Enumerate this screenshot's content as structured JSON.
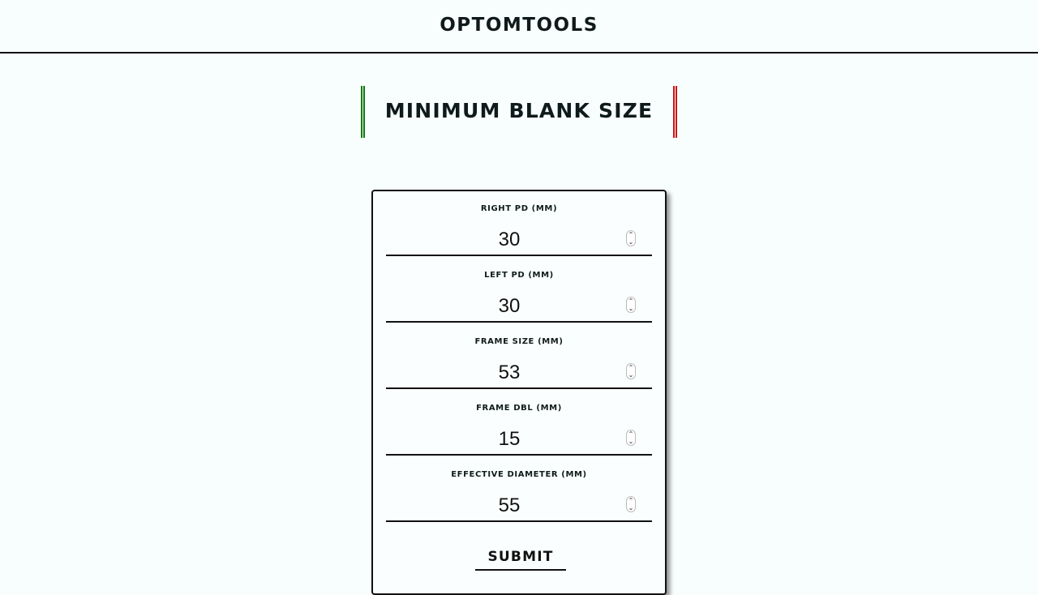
{
  "header": {
    "brand": "OPTOMTOOLS"
  },
  "page": {
    "title": "MINIMUM BLANK SIZE",
    "accent_left": "#0a7a0a",
    "accent_right": "#d01010"
  },
  "form": {
    "fields": [
      {
        "label": "RIGHT PD (MM)",
        "value": "30"
      },
      {
        "label": "LEFT PD (MM)",
        "value": "30"
      },
      {
        "label": "FRAME SIZE (MM)",
        "value": "53"
      },
      {
        "label": "FRAME DBL (MM)",
        "value": "15"
      },
      {
        "label": "EFFECTIVE DIAMETER (MM)",
        "value": "55"
      }
    ],
    "submit_label": "SUBMIT"
  }
}
